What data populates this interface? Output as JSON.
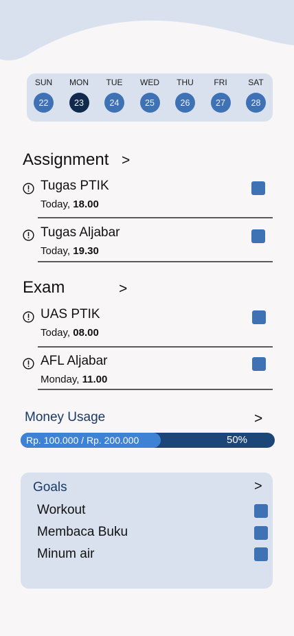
{
  "calendar": {
    "days": [
      {
        "name": "SUN",
        "num": "22"
      },
      {
        "name": "MON",
        "num": "23"
      },
      {
        "name": "TUE",
        "num": "24"
      },
      {
        "name": "WED",
        "num": "25"
      },
      {
        "name": "THU",
        "num": "26"
      },
      {
        "name": "FRI",
        "num": "27"
      },
      {
        "name": "SAT",
        "num": "28"
      }
    ],
    "selected": "23"
  },
  "assignment": {
    "title": "Assignment",
    "chevron": ">",
    "items": [
      {
        "title": "Tugas PTIK",
        "day": "Today,",
        "time": "18.00"
      },
      {
        "title": "Tugas Aljabar",
        "day": "Today,",
        "time": "19.30"
      }
    ]
  },
  "exam": {
    "title": "Exam",
    "chevron": ">",
    "items": [
      {
        "title": "UAS PTIK",
        "day": "Today,",
        "time": "08.00"
      },
      {
        "title": "AFL Aljabar",
        "day": "Monday,",
        "time": "11.00"
      }
    ]
  },
  "money": {
    "title": "Money Usage",
    "chevron": ">",
    "amount_text": "Rp. 100.000 / Rp. 200.000",
    "percent_text": "50%",
    "progress": 0.5
  },
  "goals": {
    "title": "Goals",
    "chevron": ">",
    "items": [
      {
        "label": "Workout"
      },
      {
        "label": "Membaca Buku"
      },
      {
        "label": "Minum air"
      }
    ]
  },
  "colors": {
    "accent": "#3f72b4",
    "selected_day": "#0f2a4d",
    "panel": "#d9e1ef",
    "bar_track": "#1c4578",
    "bar_fill": "#3e82d6"
  }
}
